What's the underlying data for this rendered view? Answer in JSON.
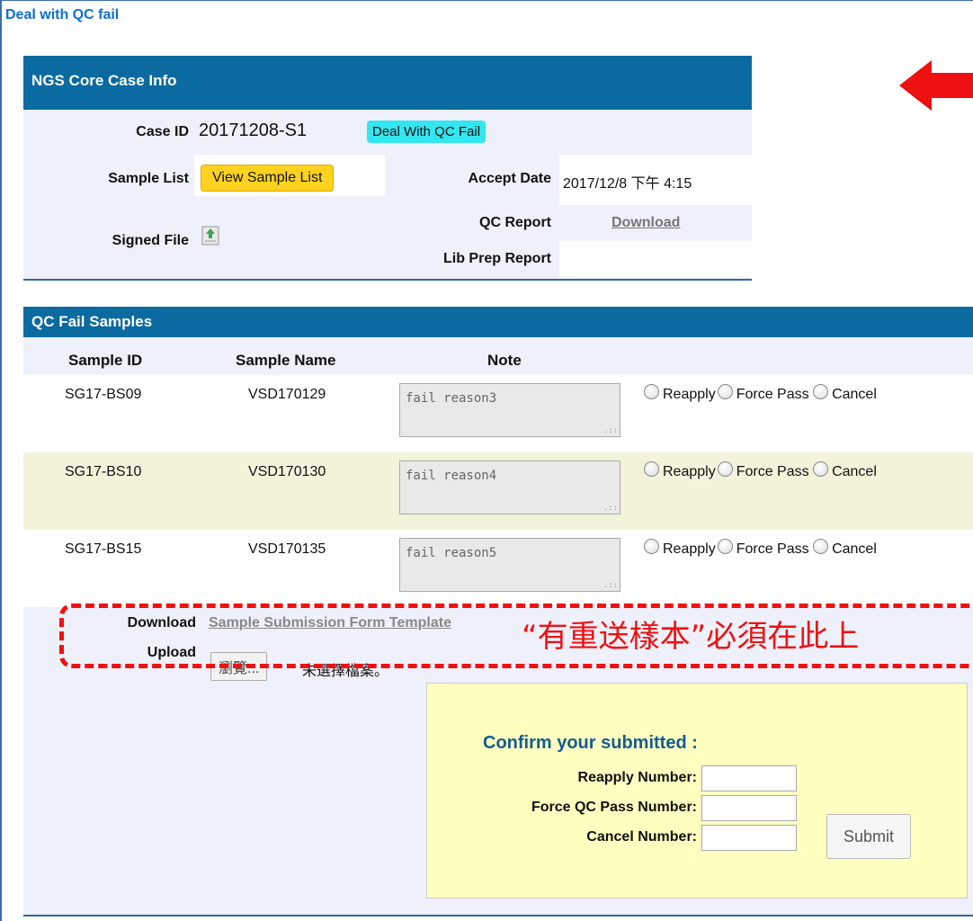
{
  "page_title": "Deal with QC fail",
  "case_info": {
    "header": "NGS Core Case Info",
    "case_id_label": "Case ID",
    "case_id": "20171208-S1",
    "deal_button": "Deal With QC Fail",
    "sample_list_label": "Sample List",
    "view_sample_list_button": "View Sample List",
    "accept_date_label": "Accept Date",
    "accept_date": "2017/12/8 下午 4:15",
    "signed_file_label": "Signed File",
    "qc_report_label": "QC Report",
    "qc_report_link": "Download",
    "lib_prep_label": "Lib Prep Report"
  },
  "qc_fail": {
    "header": "QC Fail Samples",
    "columns": [
      "Sample ID",
      "Sample Name",
      "Note"
    ],
    "radio_options": [
      "Reapply",
      "Force Pass",
      "Cancel"
    ],
    "rows": [
      {
        "id": "SG17-BS09",
        "name": "VSD170129",
        "note": "fail reason3"
      },
      {
        "id": "SG17-BS10",
        "name": "VSD170130",
        "note": "fail reason4"
      },
      {
        "id": "SG17-BS15",
        "name": "VSD170135",
        "note": "fail reason5"
      }
    ],
    "download_label": "Download",
    "template_link": "Sample Submission Form Template",
    "upload_label": "Upload",
    "browse_button": "瀏覽...",
    "file_status": "未選擇檔案。",
    "annotation": "“有重送樣本”必須在此上"
  },
  "confirm": {
    "title": "Confirm your submitted :",
    "reapply_label": "Reapply Number:",
    "force_label": "Force QC Pass Number:",
    "cancel_label": "Cancel Number:",
    "submit": "Submit"
  },
  "colors": {
    "header_bg": "#0b6aa0",
    "title_blue": "#0b6fd6",
    "annotation_red": "#ee1111",
    "row_alt": "#f3f3dc"
  }
}
